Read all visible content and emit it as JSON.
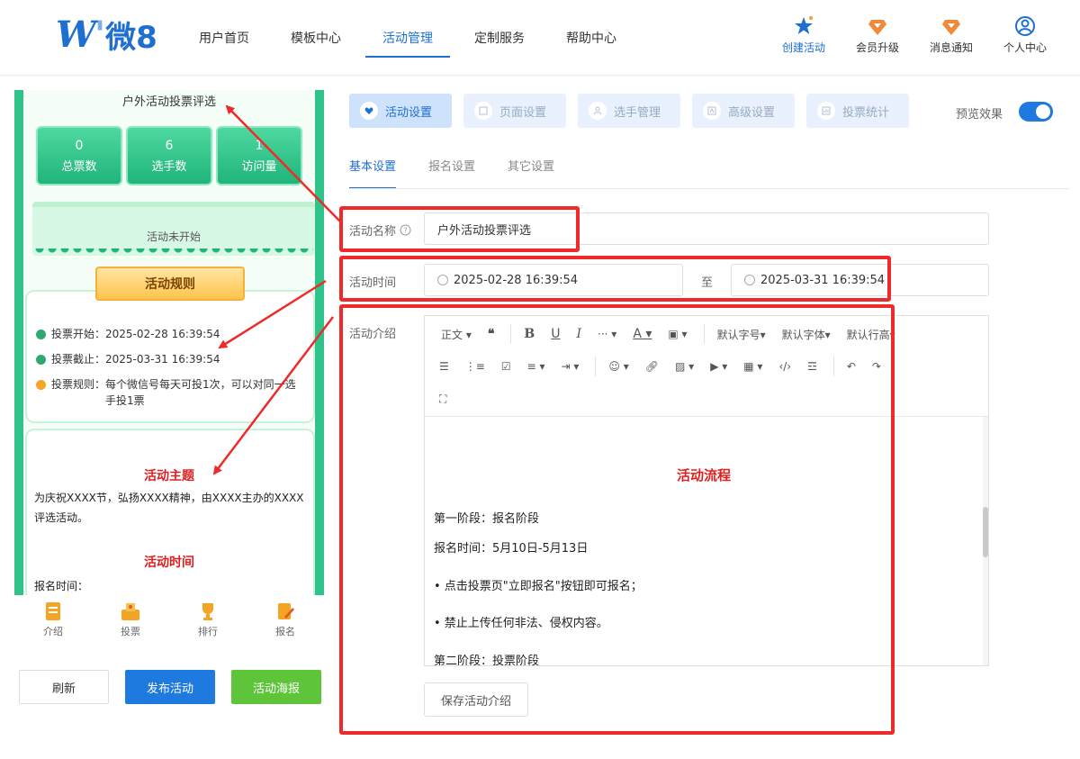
{
  "header": {
    "logo_text": "微8",
    "nav": [
      "用户首页",
      "模板中心",
      "活动管理",
      "定制服务",
      "帮助中心"
    ],
    "active_nav": 2,
    "tools": [
      {
        "label": "创建活动",
        "icon": "star-icon"
      },
      {
        "label": "会员升级",
        "icon": "diamond-icon"
      },
      {
        "label": "消息通知",
        "icon": "diamond-icon"
      },
      {
        "label": "个人中心",
        "icon": "user-icon"
      }
    ]
  },
  "preview": {
    "title": "户外活动投票评选",
    "stats": [
      {
        "value": "0",
        "label": "总票数"
      },
      {
        "value": "6",
        "label": "选手数"
      },
      {
        "value": "1",
        "label": "访问量"
      }
    ],
    "status": "活动未开始",
    "rules_title": "活动规则",
    "rules": [
      {
        "label": "投票开始：",
        "value": "2025-02-28 16:39:54"
      },
      {
        "label": "投票截止：",
        "value": "2025-03-31 16:39:54"
      },
      {
        "label": "投票规则：",
        "value": "每个微信号每天可投1次，可以对同一选手投1票"
      }
    ],
    "intro_heading1": "活动主题",
    "intro_text": "为庆祝XXXX节，弘扬XXXX精神，由XXXX主办的XXXX评选活动。",
    "intro_heading2": "活动时间",
    "intro_text2": "报名时间：",
    "bottom_nav": [
      "介绍",
      "投票",
      "排行",
      "报名"
    ],
    "buttons": {
      "refresh": "刷新",
      "publish": "发布活动",
      "poster": "活动海报"
    }
  },
  "settings": {
    "tabs": [
      "活动设置",
      "页面设置",
      "选手管理",
      "高级设置",
      "投票统计"
    ],
    "active_tab": 0,
    "preview_label": "预览效果",
    "preview_on": true,
    "sub_tabs": [
      "基本设置",
      "报名设置",
      "其它设置"
    ],
    "active_sub_tab": 0,
    "name_label": "活动名称",
    "name_value": "户外活动投票评选",
    "time_label": "活动时间",
    "start_time": "2025-02-28 16:39:54",
    "to_label": "至",
    "end_time": "2025-03-31 16:39:54",
    "intro_label": "活动介绍",
    "toolbar_row1": [
      "正文",
      "默认字号",
      "默认字体",
      "默认行高"
    ],
    "editor": {
      "heading": "活动流程",
      "lines": [
        "第一阶段：报名阶段",
        "报名时间：5月10日-5月13日",
        "• 点击投票页\"立即报名\"按钮即可报名；",
        "• 禁止上传任何非法、侵权内容。",
        "第二阶段：投票阶段"
      ]
    },
    "save_button": "保存活动介绍"
  },
  "colors": {
    "accent": "#1f6fd1",
    "phone_green": "#2fc38a",
    "annotation_red": "#ee2a2a"
  }
}
